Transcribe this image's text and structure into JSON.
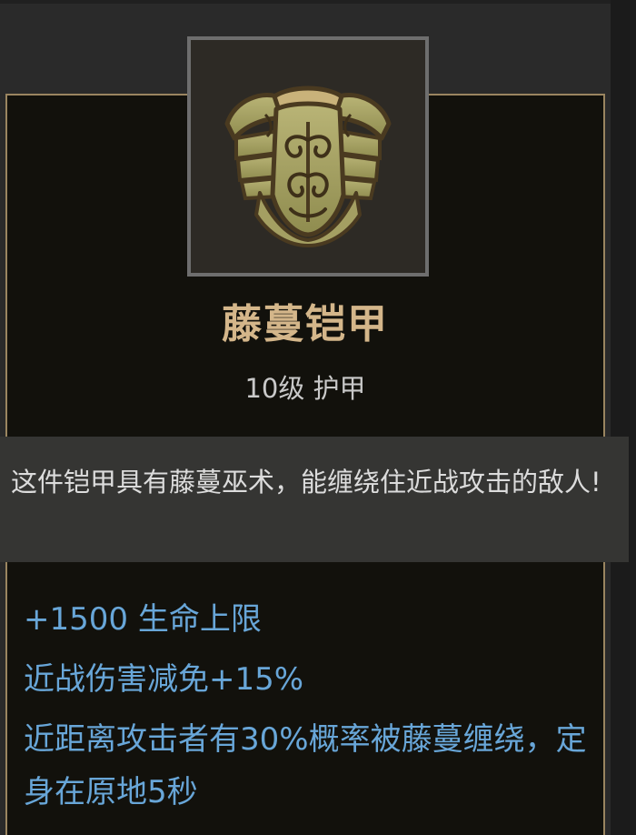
{
  "item": {
    "icon": "vine-armor-chestplate-icon",
    "name": "藤蔓铠甲",
    "subtitle": "10级 护甲",
    "description": "这件铠甲具有藤蔓巫术，能缠绕住近战攻击的敌人!",
    "stats": [
      "+1500 生命上限",
      "近战伤害减免+15%",
      "近距离攻击者有30%概率被藤蔓缠绕，定身在原地5秒"
    ]
  },
  "colors": {
    "name": "#d4b68a",
    "stat": "#68a6d8",
    "border": "#9a8560"
  }
}
